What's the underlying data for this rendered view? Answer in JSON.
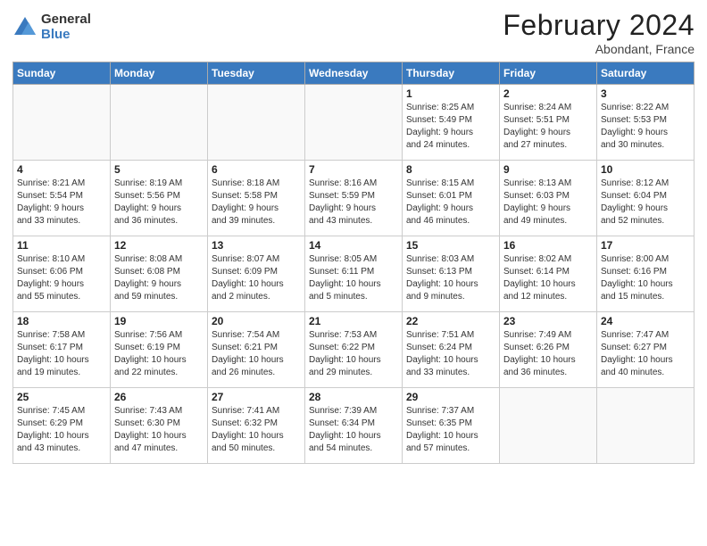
{
  "logo": {
    "general": "General",
    "blue": "Blue"
  },
  "title": "February 2024",
  "location": "Abondant, France",
  "days": [
    "Sunday",
    "Monday",
    "Tuesday",
    "Wednesday",
    "Thursday",
    "Friday",
    "Saturday"
  ],
  "weeks": [
    [
      {
        "num": "",
        "text": ""
      },
      {
        "num": "",
        "text": ""
      },
      {
        "num": "",
        "text": ""
      },
      {
        "num": "",
        "text": ""
      },
      {
        "num": "1",
        "text": "Sunrise: 8:25 AM\nSunset: 5:49 PM\nDaylight: 9 hours\nand 24 minutes."
      },
      {
        "num": "2",
        "text": "Sunrise: 8:24 AM\nSunset: 5:51 PM\nDaylight: 9 hours\nand 27 minutes."
      },
      {
        "num": "3",
        "text": "Sunrise: 8:22 AM\nSunset: 5:53 PM\nDaylight: 9 hours\nand 30 minutes."
      }
    ],
    [
      {
        "num": "4",
        "text": "Sunrise: 8:21 AM\nSunset: 5:54 PM\nDaylight: 9 hours\nand 33 minutes."
      },
      {
        "num": "5",
        "text": "Sunrise: 8:19 AM\nSunset: 5:56 PM\nDaylight: 9 hours\nand 36 minutes."
      },
      {
        "num": "6",
        "text": "Sunrise: 8:18 AM\nSunset: 5:58 PM\nDaylight: 9 hours\nand 39 minutes."
      },
      {
        "num": "7",
        "text": "Sunrise: 8:16 AM\nSunset: 5:59 PM\nDaylight: 9 hours\nand 43 minutes."
      },
      {
        "num": "8",
        "text": "Sunrise: 8:15 AM\nSunset: 6:01 PM\nDaylight: 9 hours\nand 46 minutes."
      },
      {
        "num": "9",
        "text": "Sunrise: 8:13 AM\nSunset: 6:03 PM\nDaylight: 9 hours\nand 49 minutes."
      },
      {
        "num": "10",
        "text": "Sunrise: 8:12 AM\nSunset: 6:04 PM\nDaylight: 9 hours\nand 52 minutes."
      }
    ],
    [
      {
        "num": "11",
        "text": "Sunrise: 8:10 AM\nSunset: 6:06 PM\nDaylight: 9 hours\nand 55 minutes."
      },
      {
        "num": "12",
        "text": "Sunrise: 8:08 AM\nSunset: 6:08 PM\nDaylight: 9 hours\nand 59 minutes."
      },
      {
        "num": "13",
        "text": "Sunrise: 8:07 AM\nSunset: 6:09 PM\nDaylight: 10 hours\nand 2 minutes."
      },
      {
        "num": "14",
        "text": "Sunrise: 8:05 AM\nSunset: 6:11 PM\nDaylight: 10 hours\nand 5 minutes."
      },
      {
        "num": "15",
        "text": "Sunrise: 8:03 AM\nSunset: 6:13 PM\nDaylight: 10 hours\nand 9 minutes."
      },
      {
        "num": "16",
        "text": "Sunrise: 8:02 AM\nSunset: 6:14 PM\nDaylight: 10 hours\nand 12 minutes."
      },
      {
        "num": "17",
        "text": "Sunrise: 8:00 AM\nSunset: 6:16 PM\nDaylight: 10 hours\nand 15 minutes."
      }
    ],
    [
      {
        "num": "18",
        "text": "Sunrise: 7:58 AM\nSunset: 6:17 PM\nDaylight: 10 hours\nand 19 minutes."
      },
      {
        "num": "19",
        "text": "Sunrise: 7:56 AM\nSunset: 6:19 PM\nDaylight: 10 hours\nand 22 minutes."
      },
      {
        "num": "20",
        "text": "Sunrise: 7:54 AM\nSunset: 6:21 PM\nDaylight: 10 hours\nand 26 minutes."
      },
      {
        "num": "21",
        "text": "Sunrise: 7:53 AM\nSunset: 6:22 PM\nDaylight: 10 hours\nand 29 minutes."
      },
      {
        "num": "22",
        "text": "Sunrise: 7:51 AM\nSunset: 6:24 PM\nDaylight: 10 hours\nand 33 minutes."
      },
      {
        "num": "23",
        "text": "Sunrise: 7:49 AM\nSunset: 6:26 PM\nDaylight: 10 hours\nand 36 minutes."
      },
      {
        "num": "24",
        "text": "Sunrise: 7:47 AM\nSunset: 6:27 PM\nDaylight: 10 hours\nand 40 minutes."
      }
    ],
    [
      {
        "num": "25",
        "text": "Sunrise: 7:45 AM\nSunset: 6:29 PM\nDaylight: 10 hours\nand 43 minutes."
      },
      {
        "num": "26",
        "text": "Sunrise: 7:43 AM\nSunset: 6:30 PM\nDaylight: 10 hours\nand 47 minutes."
      },
      {
        "num": "27",
        "text": "Sunrise: 7:41 AM\nSunset: 6:32 PM\nDaylight: 10 hours\nand 50 minutes."
      },
      {
        "num": "28",
        "text": "Sunrise: 7:39 AM\nSunset: 6:34 PM\nDaylight: 10 hours\nand 54 minutes."
      },
      {
        "num": "29",
        "text": "Sunrise: 7:37 AM\nSunset: 6:35 PM\nDaylight: 10 hours\nand 57 minutes."
      },
      {
        "num": "",
        "text": ""
      },
      {
        "num": "",
        "text": ""
      }
    ]
  ]
}
